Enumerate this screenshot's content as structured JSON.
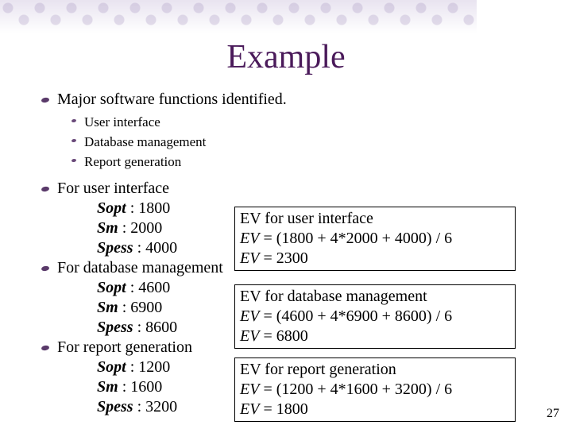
{
  "title": "Example",
  "intro": "Major software functions identified.",
  "functions": [
    "User interface",
    "Database management",
    "Report generation"
  ],
  "sections": [
    {
      "heading": "For user interface",
      "sopt": "1800",
      "sm": "2000",
      "spess": "4000"
    },
    {
      "heading": "For database management",
      "sopt": "4600",
      "sm": "6900",
      "spess": "8600"
    },
    {
      "heading": "For report generation",
      "sopt": "1200",
      "sm": "1600",
      "spess": "3200"
    }
  ],
  "labels": {
    "sopt": "Sopt",
    "sm": "Sm",
    "spess": "Spess"
  },
  "ev_boxes": [
    {
      "title": "EV for user interface",
      "formula": "EV = (1800 + 4*2000 + 4000) / 6",
      "result": "EV = 2300"
    },
    {
      "title": "EV for database management",
      "formula": "EV = (4600 + 4*6900 + 8600) / 6",
      "result": "EV = 6800"
    },
    {
      "title": "EV for report generation",
      "formula": "EV = (1200 + 4*1600 + 3200) / 6",
      "result": "EV = 1800"
    }
  ],
  "page_number": "27"
}
